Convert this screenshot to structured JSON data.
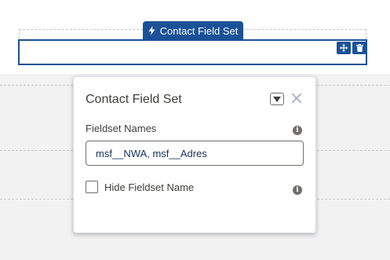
{
  "component": {
    "tab_label": "Contact Field Set",
    "tab_icon": "lightning-bolt-icon",
    "actions": [
      "move-icon",
      "delete-icon"
    ]
  },
  "popover": {
    "title": "Contact Field Set",
    "fieldset_label": "Fieldset Names",
    "fieldset_value": "msf__NWA, msf__Adres",
    "checkbox_label": "Hide Fieldset Name",
    "checkbox_checked": false,
    "info_glyph": "i"
  },
  "colors": {
    "accent": "#1b5297",
    "border": "#706e6b",
    "text": "#3e3e3c"
  }
}
